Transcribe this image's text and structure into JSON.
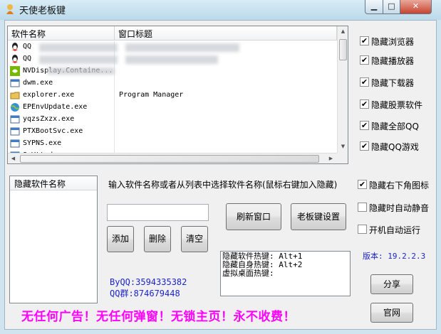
{
  "window": {
    "title": "天使老板键",
    "controls": {
      "minimize": "▁",
      "maximize": "□",
      "close": "✕"
    }
  },
  "process_list": {
    "columns": [
      "软件名称",
      "窗口标题"
    ],
    "rows": [
      {
        "name": "QQ",
        "title": "",
        "icon": "qq-icon"
      },
      {
        "name": "QQ",
        "title": "",
        "icon": "qq-icon"
      },
      {
        "name": "NVDisplay.Containe...",
        "title": "",
        "icon": "nvidia-icon"
      },
      {
        "name": "dwm.exe",
        "title": "",
        "icon": "window-icon"
      },
      {
        "name": "explorer.exe",
        "title": "Program Manager",
        "icon": "folder-icon"
      },
      {
        "name": "EPEnvUpdate.exe",
        "title": "",
        "icon": "globe-icon"
      },
      {
        "name": "yqzsZxzx.exe",
        "title": "",
        "icon": "window-icon"
      },
      {
        "name": "PTXBootSvc.exe",
        "title": "",
        "icon": "window-icon"
      },
      {
        "name": "SYPNS.exe",
        "title": "",
        "icon": "window-icon"
      },
      {
        "name": "SgVttod.exe",
        "title": "",
        "icon": "window-icon"
      }
    ]
  },
  "hide_options": {
    "browser": {
      "label": "隐藏浏览器",
      "checked": true
    },
    "player": {
      "label": "隐藏播放器",
      "checked": true
    },
    "downloader": {
      "label": "隐藏下载器",
      "checked": true
    },
    "stock": {
      "label": "隐藏股票软件",
      "checked": true
    },
    "all_qq": {
      "label": "隐藏全部QQ",
      "checked": true
    },
    "qq_game": {
      "label": "隐藏QQ游戏",
      "checked": true
    }
  },
  "hidden_list": {
    "header": "隐藏软件名称"
  },
  "hint": "输入软件名称或者从列表中选择软件名称(鼠标右键加入隐藏)",
  "name_input": {
    "value": ""
  },
  "buttons": {
    "add": "添加",
    "delete": "删除",
    "clear": "清空",
    "refresh": "刷新窗口",
    "settings": "老板键设置",
    "share": "分享",
    "website": "官网"
  },
  "settings": {
    "tray_icon": {
      "label": "隐藏右下角图标",
      "checked": true
    },
    "mute": {
      "label": "隐藏时自动静音",
      "checked": false
    },
    "autostart": {
      "label": "开机自动运行",
      "checked": false
    }
  },
  "hotkeys_text": "隐藏软件热键: Alt+1\n隐藏自身热键: Alt+2\n虚拟桌面热键:",
  "contact": {
    "byqq": "ByQQ:3594335382",
    "qq_group": "QQ群:874679448"
  },
  "version": "版本: 19.2.2.3",
  "slogan": "无任何广告！无任何弹窗！无锁主页！永不收费！"
}
